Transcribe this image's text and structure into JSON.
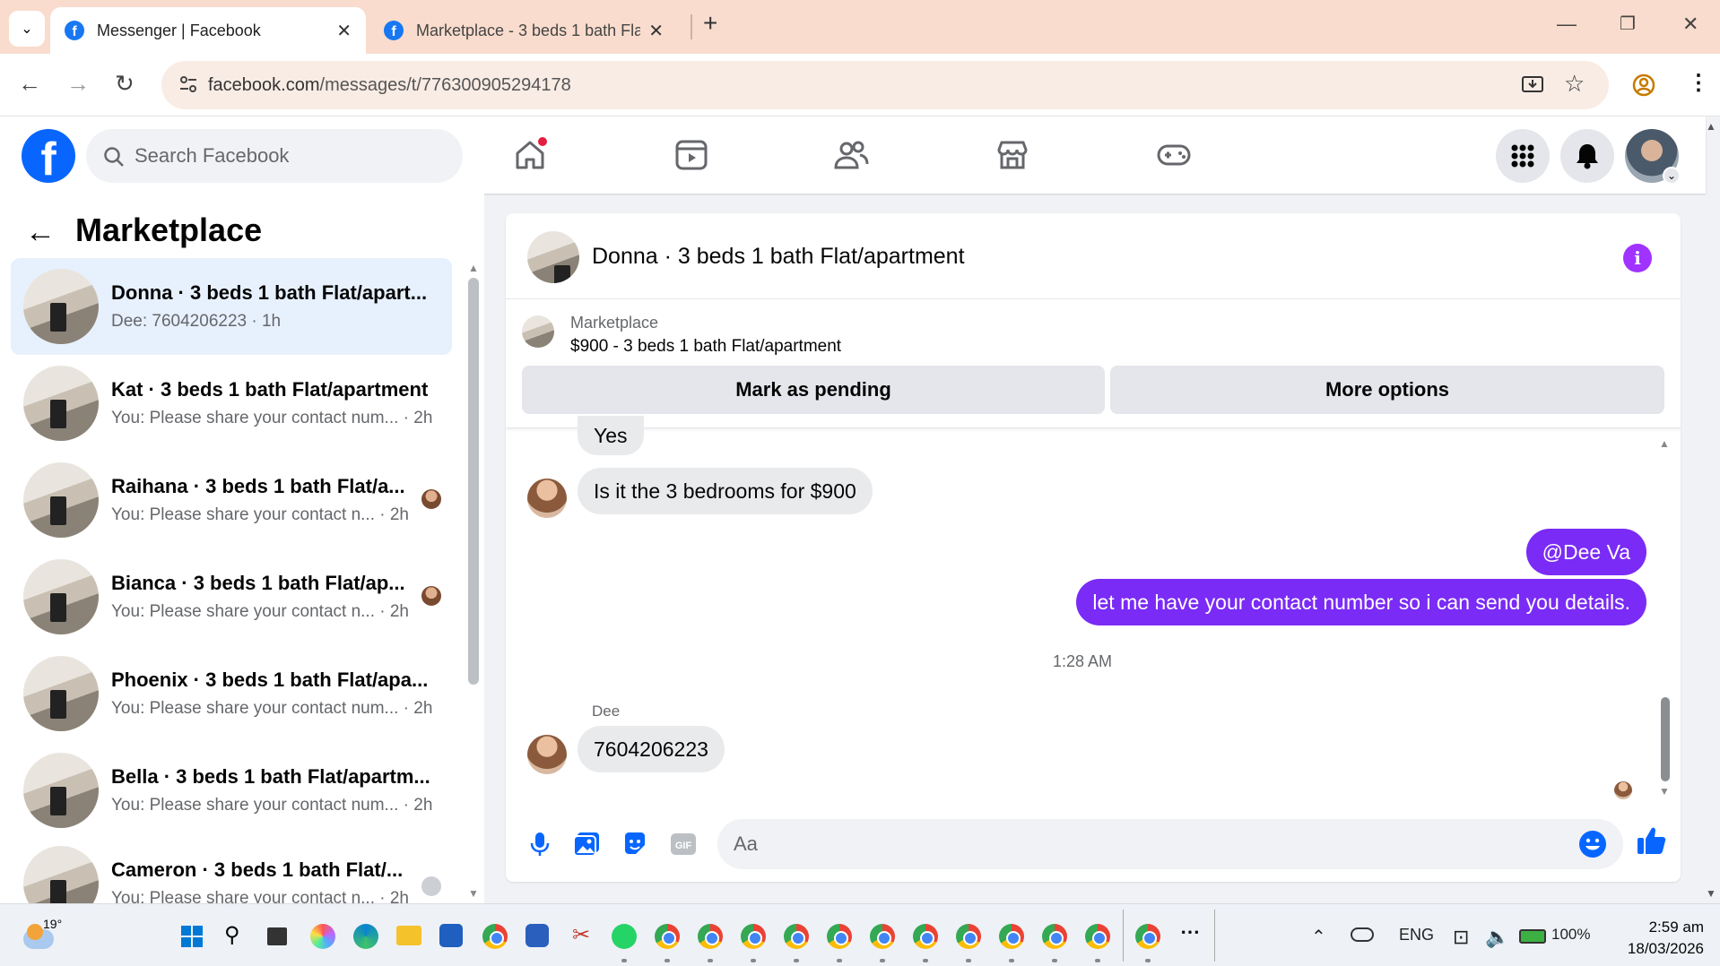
{
  "browser": {
    "tabs": [
      {
        "label": "Messenger | Facebook",
        "active": true
      },
      {
        "label": "Marketplace - 3 beds 1 bath Fla",
        "active": false
      }
    ],
    "url_domain": "facebook.com",
    "url_path": "/messages/t/776300905294178"
  },
  "facebook": {
    "search_placeholder": "Search Facebook"
  },
  "sidebar": {
    "title": "Marketplace",
    "conversations": [
      {
        "name": "Donna · 3 beds 1 bath Flat/apart...",
        "preview": "Dee: 7604206223 · 1h",
        "selected": true
      },
      {
        "name": "Kat · 3 beds 1 bath Flat/apartment",
        "preview": "You: Please share your contact num... · 2h"
      },
      {
        "name": "Raihana · 3 beds 1 bath Flat/a...",
        "preview": "You: Please share your contact n... · 2h"
      },
      {
        "name": "Bianca · 3 beds 1 bath Flat/ap...",
        "preview": "You: Please share your contact n... · 2h"
      },
      {
        "name": "Phoenix · 3 beds 1 bath Flat/apa...",
        "preview": "You: Please share your contact num... · 2h"
      },
      {
        "name": "Bella · 3 beds 1 bath Flat/apartm...",
        "preview": "You: Please share your contact num... · 2h"
      },
      {
        "name": "Cameron · 3 beds 1 bath Flat/...",
        "preview": "You: Please share your contact n... · 2h"
      }
    ]
  },
  "chat": {
    "title": "Donna · 3 beds 1 bath Flat/apartment",
    "listing_label": "Marketplace",
    "listing_price": "$900 - 3 beds 1 bath Flat/apartment",
    "mark_pending": "Mark as pending",
    "more_options": "More options",
    "messages": [
      {
        "text": "Yes",
        "dir": "in"
      },
      {
        "text": "Is it the 3 bedrooms for $900",
        "dir": "in"
      },
      {
        "text": "@Dee Va",
        "dir": "out"
      },
      {
        "text": "let me have your contact number so i can send you details.",
        "dir": "out"
      },
      {
        "text": "7604206223",
        "dir": "in",
        "sender": "Dee"
      }
    ],
    "timestamp": "1:28 AM",
    "composer_placeholder": "Aa"
  },
  "taskbar": {
    "weather": "19°",
    "lang": "ENG",
    "battery": "100%",
    "time": "2:59 am",
    "date": "18/03/2026"
  },
  "colors": {
    "fb_blue": "#0866ff",
    "messenger_purple": "#7a2bf5",
    "selected_bg": "#e7f0fd"
  }
}
